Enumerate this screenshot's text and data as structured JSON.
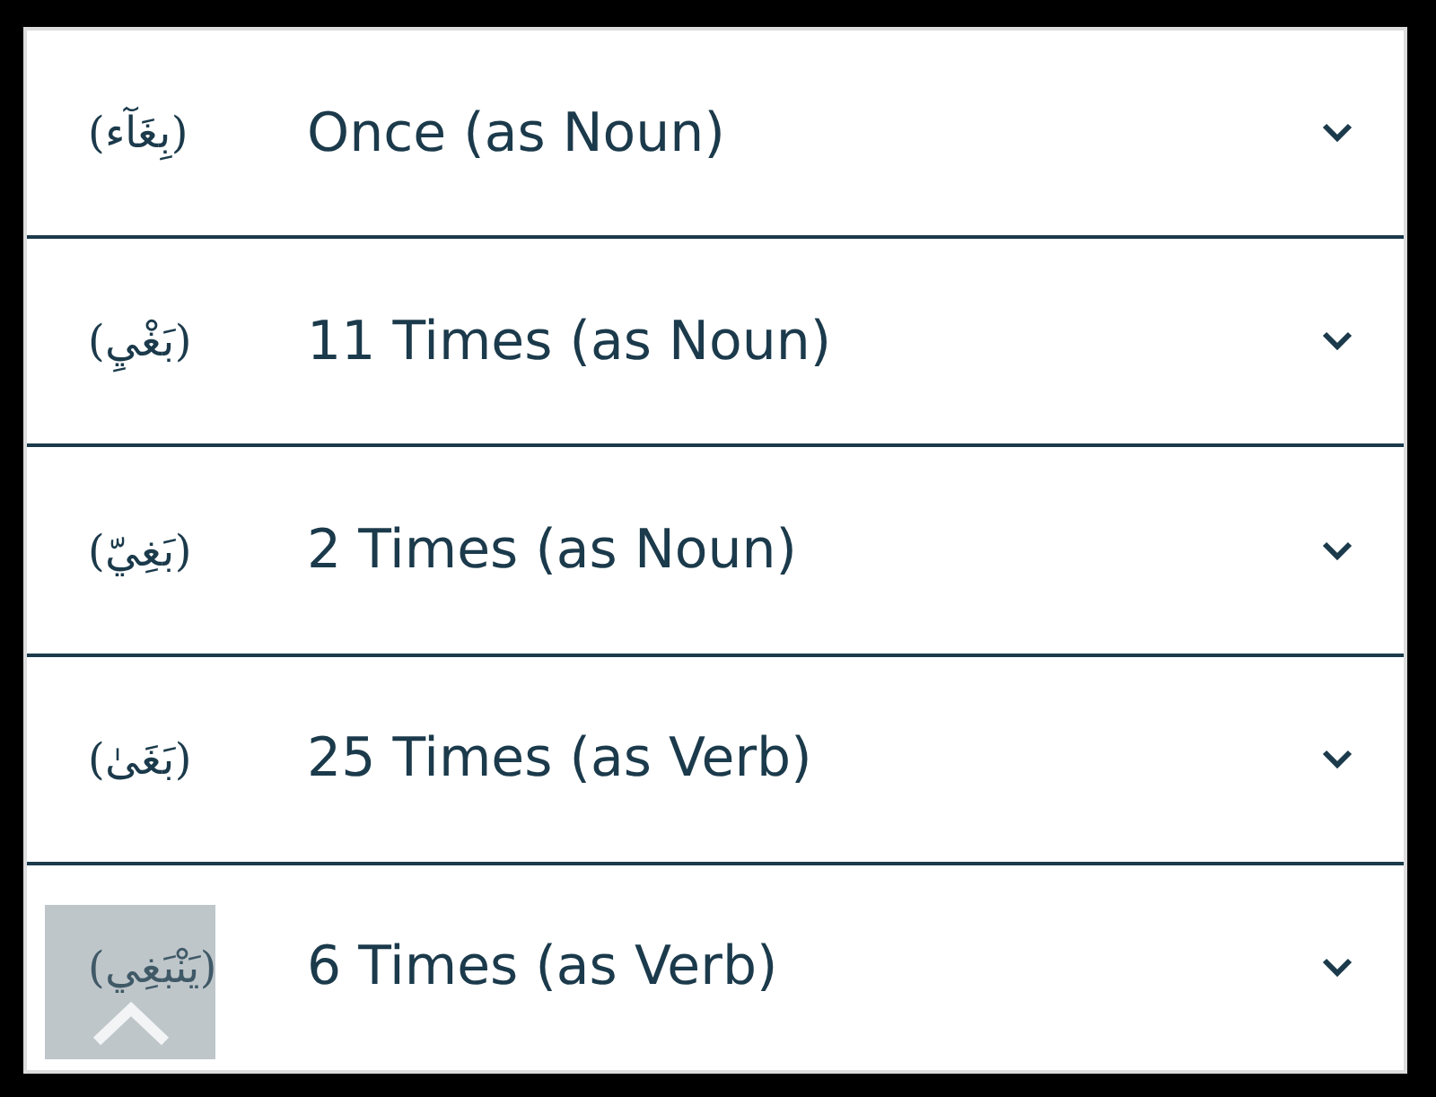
{
  "rows": [
    {
      "arabic": "(بِغَآء)",
      "label": "Once (as Noun)",
      "expanded": false
    },
    {
      "arabic": "(بَغْيِ)",
      "label": "11 Times (as Noun)",
      "expanded": false
    },
    {
      "arabic": "(بَغِيّ)",
      "label": "2 Times (as Noun)",
      "expanded": false
    },
    {
      "arabic": "(بَغَىٰ)",
      "label": "25 Times (as Verb)",
      "expanded": false
    },
    {
      "arabic": "(يَنْبَغِي)",
      "label": "6 Times (as Verb)",
      "expanded": false
    }
  ],
  "scroll_top_button": {
    "kind": "scroll-top"
  }
}
